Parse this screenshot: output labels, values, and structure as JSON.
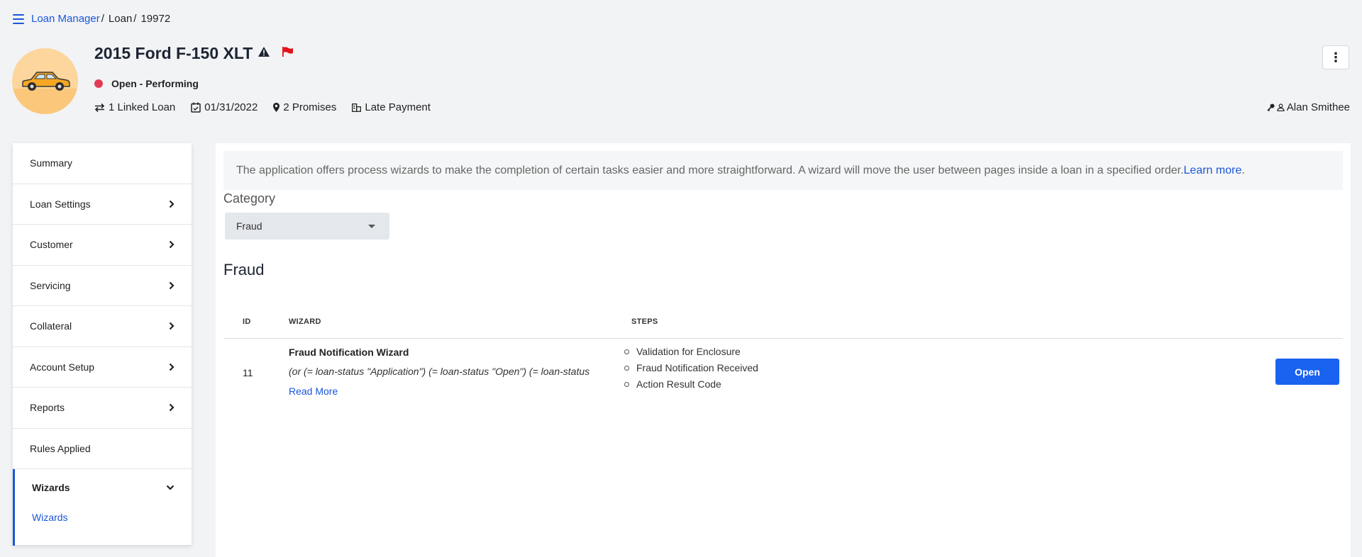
{
  "breadcrumb": {
    "items": [
      "Loan Manager",
      "Loan",
      "19972"
    ],
    "sep": "/"
  },
  "header": {
    "title": "2015 Ford F-150 XLT",
    "status": "Open - Performing",
    "status_color": "#e23b54",
    "linked_loans": "1 Linked Loan",
    "date": "01/31/2022",
    "promises": "2 Promises",
    "late_payment": "Late Payment",
    "user": "Alan Smithee",
    "kebab": "⋮"
  },
  "sidebar": {
    "items": [
      {
        "label": "Summary",
        "chevron": ""
      },
      {
        "label": "Loan Settings",
        "chevron": "›"
      },
      {
        "label": "Customer",
        "chevron": "›"
      },
      {
        "label": "Servicing",
        "chevron": "›"
      },
      {
        "label": "Collateral",
        "chevron": "›"
      },
      {
        "label": "Account Setup",
        "chevron": "›"
      },
      {
        "label": "Reports",
        "chevron": "›"
      },
      {
        "label": "Rules Applied",
        "chevron": ""
      }
    ],
    "active": {
      "label": "Wizards",
      "chevron": "⌄"
    },
    "sub_item": "Wizards"
  },
  "main": {
    "info_text": "The application offers process wizards to make the completion of certain tasks easier and more straightforward. A wizard will move the user between pages inside a loan in a specified order.",
    "info_link": "Learn more",
    "info_end": ".",
    "category_label": "Category",
    "category_value": "Fraud",
    "section_title": "Fraud",
    "table": {
      "headers": {
        "id": "ID",
        "wizard": "WIZARD",
        "steps": "STEPS"
      },
      "rows": [
        {
          "id": "11",
          "name": "Fraud Notification Wizard",
          "condition": "(or (= loan-status \"Application\") (= loan-status \"Open\") (= loan-status",
          "read_more": "Read More",
          "steps": [
            "Validation for Enclosure",
            "Fraud Notification Received",
            "Action Result Code"
          ],
          "action": "Open"
        }
      ]
    }
  },
  "colors": {
    "accent": "#1a56db",
    "button": "#1a62f0",
    "flag": "#e3131b"
  }
}
